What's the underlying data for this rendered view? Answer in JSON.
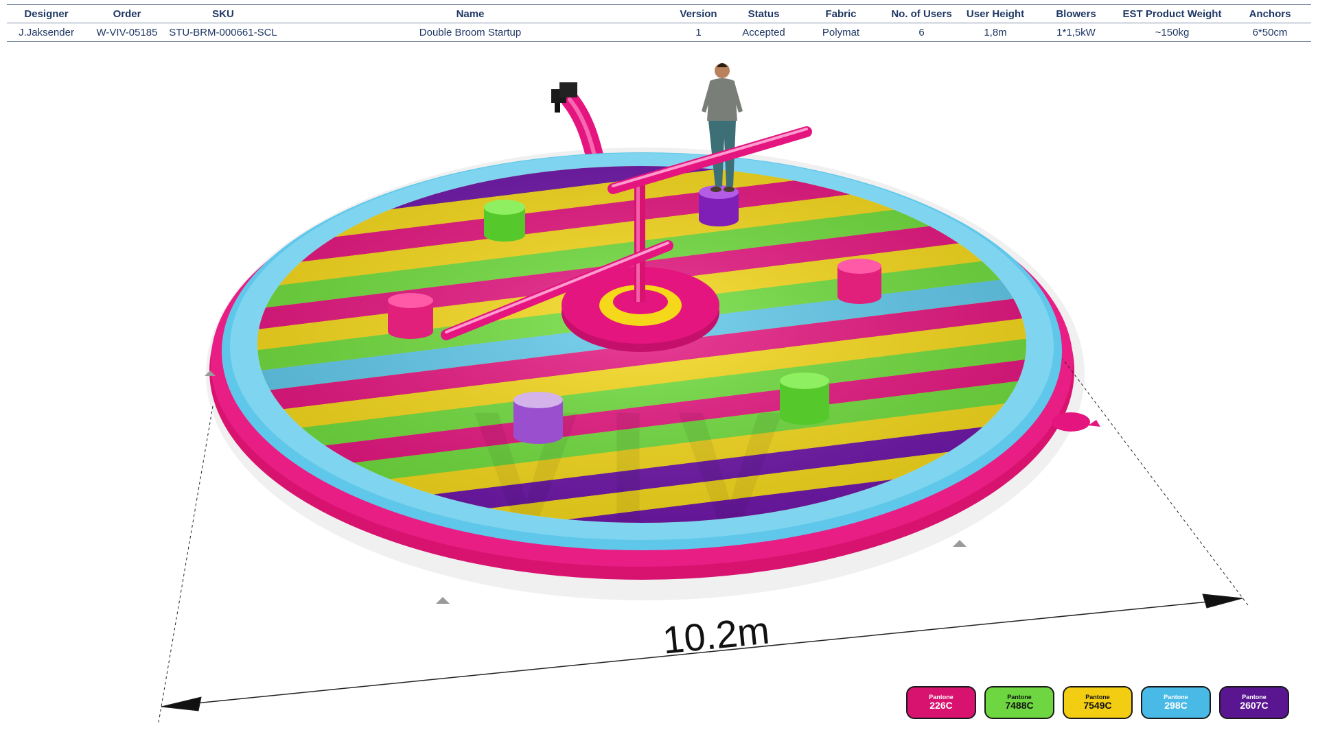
{
  "spec_table": {
    "headers": [
      "Designer",
      "Order",
      "SKU",
      "Name",
      "Version",
      "Status",
      "Fabric",
      "No. of Users",
      "User  Height",
      "Blowers",
      "EST Product Weight",
      "Anchors"
    ],
    "row": [
      "J.Jaksender",
      "W-VIV-05185",
      "STU-BRM-000661-SCL",
      "Double Broom Startup",
      "1",
      "Accepted",
      "Polymat",
      "6",
      "1,8m",
      "1*1,5kW",
      "~150kg",
      "6*50cm"
    ]
  },
  "dimension_label": "10.2m",
  "watermark_text": "VIV",
  "colors": {
    "pink": "#e4157f",
    "green": "#6fdc3c",
    "yellow": "#f5d81a",
    "blue": "#5fc8ea",
    "purple": "#6e16a8"
  },
  "swatches": [
    {
      "brand": "Pantone",
      "code": "226C",
      "color": "#d8136f",
      "text_color": "#ffffff"
    },
    {
      "brand": "Pantone",
      "code": "7488C",
      "color": "#6ed640",
      "text_color": "#111111"
    },
    {
      "brand": "Pantone",
      "code": "7549C",
      "color": "#f3cd12",
      "text_color": "#111111"
    },
    {
      "brand": "Pantone",
      "code": "298C",
      "color": "#49b9e6",
      "text_color": "#ffffff"
    },
    {
      "brand": "Pantone",
      "code": "2607C",
      "color": "#5a1590",
      "text_color": "#ffffff"
    }
  ]
}
